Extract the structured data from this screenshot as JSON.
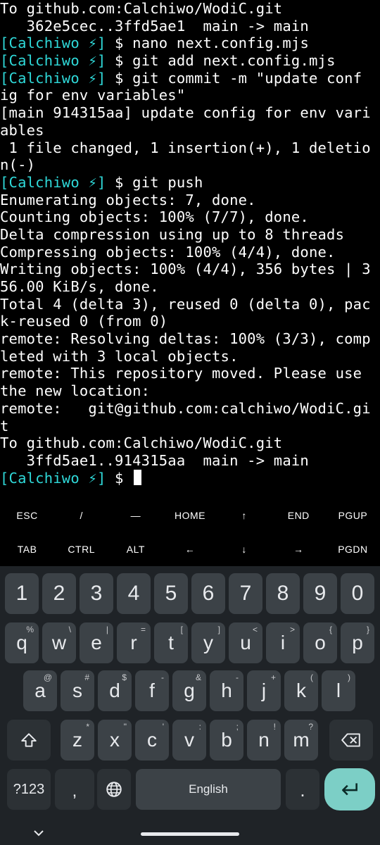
{
  "terminal": {
    "prompt_user": "[Calchiwo ⚡]",
    "prompt_symbol": " $ ",
    "lines": [
      {
        "text": "To github.com:Calchiwo/WodiC.git"
      },
      {
        "text": "   362e5cec..3ffd5ae1  main -> main"
      },
      {
        "prompt": true,
        "text": "nano next.config.mjs"
      },
      {
        "prompt": true,
        "text": "git add next.config.mjs"
      },
      {
        "prompt": true,
        "text": "git commit -m \"update conf"
      },
      {
        "text": "ig for env variables\""
      },
      {
        "text": "[main 914315aa] update config for env vari"
      },
      {
        "text": "ables"
      },
      {
        "text": " 1 file changed, 1 insertion(+), 1 deletio"
      },
      {
        "text": "n(-)"
      },
      {
        "prompt": true,
        "text": "git push"
      },
      {
        "text": "Enumerating objects: 7, done."
      },
      {
        "text": "Counting objects: 100% (7/7), done."
      },
      {
        "text": "Delta compression using up to 8 threads"
      },
      {
        "text": "Compressing objects: 100% (4/4), done."
      },
      {
        "text": "Writing objects: 100% (4/4), 356 bytes | 3"
      },
      {
        "text": "56.00 KiB/s, done."
      },
      {
        "text": "Total 4 (delta 3), reused 0 (delta 0), pac"
      },
      {
        "text": "k-reused 0 (from 0)"
      },
      {
        "text": "remote: Resolving deltas: 100% (3/3), comp"
      },
      {
        "text": "leted with 3 local objects."
      },
      {
        "text": "remote: This repository moved. Please use"
      },
      {
        "text": "the new location:"
      },
      {
        "text": "remote:   git@github.com:calchiwo/WodiC.gi"
      },
      {
        "text": "t"
      },
      {
        "text": "To github.com:Calchiwo/WodiC.git"
      },
      {
        "text": "   3ffd5ae1..914315aa  main -> main"
      },
      {
        "prompt": true,
        "text": "",
        "cursor": true
      }
    ]
  },
  "extra_keys": {
    "row1": [
      {
        "label": "ESC",
        "name": "esc-key"
      },
      {
        "label": "/",
        "name": "slash-key"
      },
      {
        "label": "—",
        "name": "dash-key"
      },
      {
        "label": "HOME",
        "name": "home-key"
      },
      {
        "label": "↑",
        "name": "arrow-up-key"
      },
      {
        "label": "END",
        "name": "end-key"
      },
      {
        "label": "PGUP",
        "name": "pgup-key"
      }
    ],
    "row2": [
      {
        "label": "TAB",
        "name": "tab-key"
      },
      {
        "label": "CTRL",
        "name": "ctrl-key"
      },
      {
        "label": "ALT",
        "name": "alt-key"
      },
      {
        "label": "←",
        "name": "arrow-left-key"
      },
      {
        "label": "↓",
        "name": "arrow-down-key"
      },
      {
        "label": "→",
        "name": "arrow-right-key"
      },
      {
        "label": "PGDN",
        "name": "pgdn-key"
      }
    ]
  },
  "keyboard": {
    "row_numbers": [
      {
        "label": "1"
      },
      {
        "label": "2"
      },
      {
        "label": "3"
      },
      {
        "label": "4"
      },
      {
        "label": "5"
      },
      {
        "label": "6"
      },
      {
        "label": "7"
      },
      {
        "label": "8"
      },
      {
        "label": "9"
      },
      {
        "label": "0"
      }
    ],
    "row_top": [
      {
        "label": "q",
        "hint": "%"
      },
      {
        "label": "w",
        "hint": "\\"
      },
      {
        "label": "e",
        "hint": "|"
      },
      {
        "label": "r",
        "hint": "="
      },
      {
        "label": "t",
        "hint": "["
      },
      {
        "label": "y",
        "hint": "]"
      },
      {
        "label": "u",
        "hint": "<"
      },
      {
        "label": "i",
        "hint": ">"
      },
      {
        "label": "o",
        "hint": "{"
      },
      {
        "label": "p",
        "hint": "}"
      }
    ],
    "row_middle": [
      {
        "label": "a",
        "hint": "@"
      },
      {
        "label": "s",
        "hint": "#"
      },
      {
        "label": "d",
        "hint": "$"
      },
      {
        "label": "f",
        "hint": "-"
      },
      {
        "label": "g",
        "hint": "&"
      },
      {
        "label": "h",
        "hint": "-"
      },
      {
        "label": "j",
        "hint": "+"
      },
      {
        "label": "k",
        "hint": "("
      },
      {
        "label": "l",
        "hint": ")"
      }
    ],
    "row_bottom": [
      {
        "label": "z",
        "hint": "*"
      },
      {
        "label": "x",
        "hint": "\""
      },
      {
        "label": "c",
        "hint": "'"
      },
      {
        "label": "v",
        "hint": ":"
      },
      {
        "label": "b",
        "hint": ";"
      },
      {
        "label": "n",
        "hint": "!"
      },
      {
        "label": "m",
        "hint": "?"
      }
    ],
    "symbols_label": "?123",
    "comma_label": ",",
    "space_label": "English",
    "period_label": ".",
    "shift_icon": "shift-icon",
    "backspace_icon": "backspace-icon",
    "globe_icon": "globe-icon",
    "enter_icon": "enter-icon"
  },
  "navbar": {
    "chevron_icon": "chevron-down-icon"
  },
  "colors": {
    "prompt_user": "#2fd9d9",
    "terminal_bg": "#000000",
    "keyboard_bg": "#1f2327",
    "key_bg": "#3c4247",
    "enter_bg": "#7ccfc6"
  }
}
